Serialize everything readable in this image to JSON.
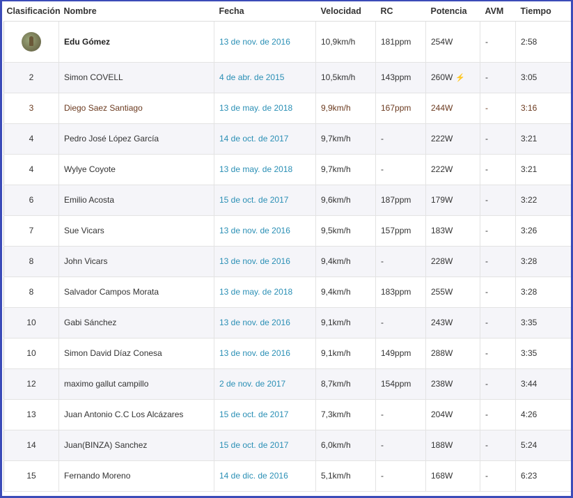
{
  "header": {
    "rank": "Clasificación",
    "name": "Nombre",
    "date": "Fecha",
    "speed": "Velocidad",
    "hr": "RC",
    "power": "Potencia",
    "vam": "AVM",
    "time": "Tiempo"
  },
  "icons": {
    "avatar": "user-avatar-photo",
    "power": "lightning-icon"
  },
  "colors": {
    "border": "#3b4bb8",
    "date_link": "#2a8fb5",
    "highlight_text": "#6b3a1f"
  },
  "rows": [
    {
      "rank": "",
      "name": "Edu Gómez",
      "date": "13 de nov. de 2016",
      "speed": "10,9km/h",
      "hr": "181ppm",
      "power": "254W",
      "vam": "-",
      "time": "2:58"
    },
    {
      "rank": "2",
      "name": "Simon COVELL",
      "date": "4 de abr. de 2015",
      "speed": "10,5km/h",
      "hr": "143ppm",
      "power": "260W",
      "vam": "-",
      "time": "3:05"
    },
    {
      "rank": "3",
      "name": "Diego Saez Santiago",
      "date": "13 de may. de 2018",
      "speed": "9,9km/h",
      "hr": "167ppm",
      "power": "244W",
      "vam": "-",
      "time": "3:16"
    },
    {
      "rank": "4",
      "name": "Pedro José López García",
      "date": "14 de oct. de 2017",
      "speed": "9,7km/h",
      "hr": "-",
      "power": "222W",
      "vam": "-",
      "time": "3:21"
    },
    {
      "rank": "4",
      "name": "Wylye Coyote",
      "date": "13 de may. de 2018",
      "speed": "9,7km/h",
      "hr": "-",
      "power": "222W",
      "vam": "-",
      "time": "3:21"
    },
    {
      "rank": "6",
      "name": "Emilio Acosta",
      "date": "15 de oct. de 2017",
      "speed": "9,6km/h",
      "hr": "187ppm",
      "power": "179W",
      "vam": "-",
      "time": "3:22"
    },
    {
      "rank": "7",
      "name": "Sue Vicars",
      "date": "13 de nov. de 2016",
      "speed": "9,5km/h",
      "hr": "157ppm",
      "power": "183W",
      "vam": "-",
      "time": "3:26"
    },
    {
      "rank": "8",
      "name": "John Vicars",
      "date": "13 de nov. de 2016",
      "speed": "9,4km/h",
      "hr": "-",
      "power": "228W",
      "vam": "-",
      "time": "3:28"
    },
    {
      "rank": "8",
      "name": "Salvador Campos Morata",
      "date": "13 de may. de 2018",
      "speed": "9,4km/h",
      "hr": "183ppm",
      "power": "255W",
      "vam": "-",
      "time": "3:28"
    },
    {
      "rank": "10",
      "name": "Gabi Sánchez",
      "date": "13 de nov. de 2016",
      "speed": "9,1km/h",
      "hr": "-",
      "power": "243W",
      "vam": "-",
      "time": "3:35"
    },
    {
      "rank": "10",
      "name": "Simon David Díaz Conesa",
      "date": "13 de nov. de 2016",
      "speed": "9,1km/h",
      "hr": "149ppm",
      "power": "288W",
      "vam": "-",
      "time": "3:35"
    },
    {
      "rank": "12",
      "name": "maximo gallut campillo",
      "date": "2 de nov. de 2017",
      "speed": "8,7km/h",
      "hr": "154ppm",
      "power": "238W",
      "vam": "-",
      "time": "3:44"
    },
    {
      "rank": "13",
      "name": "Juan Antonio C.C Los Alcázares",
      "date": "15 de oct. de 2017",
      "speed": "7,3km/h",
      "hr": "-",
      "power": "204W",
      "vam": "-",
      "time": "4:26"
    },
    {
      "rank": "14",
      "name": "Juan(BINZA) Sanchez",
      "date": "15 de oct. de 2017",
      "speed": "6,0km/h",
      "hr": "-",
      "power": "188W",
      "vam": "-",
      "time": "5:24"
    },
    {
      "rank": "15",
      "name": "Fernando Moreno",
      "date": "14 de dic. de 2016",
      "speed": "5,1km/h",
      "hr": "-",
      "power": "168W",
      "vam": "-",
      "time": "6:23"
    }
  ]
}
